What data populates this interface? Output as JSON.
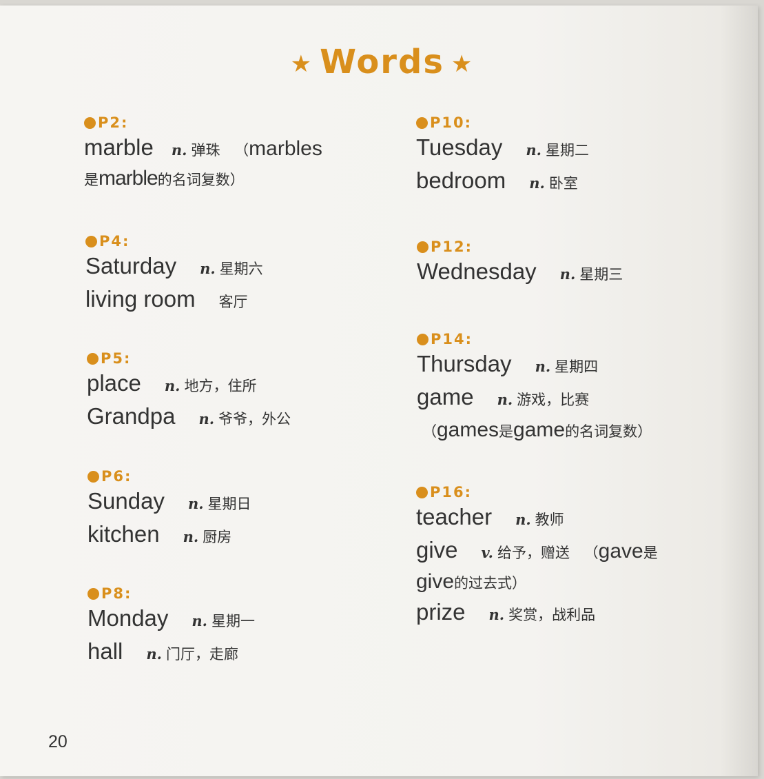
{
  "title": "Words",
  "page_number": "20",
  "left": [
    {
      "heading": "P2:",
      "lines": [
        {
          "word": "marble",
          "pos": "n.",
          "meaning": "弹珠",
          "note": {
            "open": " （",
            "en1": "marbles",
            "cn1": "",
            "tail": ""
          }
        },
        {
          "note_line": {
            "cn_a": "是",
            "en": "marble",
            "cn_b": "的名词复数）"
          }
        }
      ]
    },
    {
      "heading": "P4:",
      "lines": [
        {
          "word": "Saturday",
          "pos": "n.",
          "meaning": "星期六"
        },
        {
          "word": "living room",
          "pos": "",
          "meaning": "客厅"
        }
      ]
    },
    {
      "heading": "P5:",
      "lines": [
        {
          "word": "place",
          "pos": "n.",
          "meaning": "地方，住所"
        },
        {
          "word": "Grandpa",
          "pos": "n.",
          "meaning": "爷爷，外公"
        }
      ]
    },
    {
      "heading": "P6:",
      "lines": [
        {
          "word": "Sunday",
          "pos": "n.",
          "meaning": "星期日"
        },
        {
          "word": "kitchen",
          "pos": "n.",
          "meaning": "厨房"
        }
      ]
    },
    {
      "heading": "P8:",
      "lines": [
        {
          "word": "Monday",
          "pos": "n.",
          "meaning": "星期一"
        },
        {
          "word": "hall",
          "pos": "n.",
          "meaning": "门厅，走廊"
        }
      ]
    }
  ],
  "right": [
    {
      "heading": "P10:",
      "lines": [
        {
          "word": "Tuesday",
          "pos": "n.",
          "meaning": "星期二"
        },
        {
          "word": "bedroom",
          "pos": "n.",
          "meaning": "卧室"
        }
      ]
    },
    {
      "heading": "P12:",
      "lines": [
        {
          "word": "Wednesday",
          "pos": "n.",
          "meaning": "星期三"
        }
      ]
    },
    {
      "heading": "P14:",
      "lines": [
        {
          "word": "Thursday",
          "pos": "n.",
          "meaning": "星期四"
        },
        {
          "word": "game",
          "pos": "n.",
          "meaning": "游戏，比赛"
        },
        {
          "note_line": {
            "cn_a": "（",
            "en": "games",
            "cn_b": "是",
            "en2": "game",
            "cn_c": "的名词复数）"
          }
        }
      ]
    },
    {
      "heading": "P16:",
      "lines": [
        {
          "word": "teacher",
          "pos": "n.",
          "meaning": "教师"
        },
        {
          "word": "give",
          "pos": "v.",
          "meaning": "给予，赠送",
          "note": {
            "open": " （",
            "en1": "gave",
            "cn1": "是",
            "tail": ""
          }
        },
        {
          "note_line": {
            "cn_a": "",
            "en": "give",
            "cn_b": "的过去式）"
          }
        },
        {
          "word": "prize",
          "pos": "n.",
          "meaning": "奖赏，战利品"
        }
      ]
    }
  ]
}
